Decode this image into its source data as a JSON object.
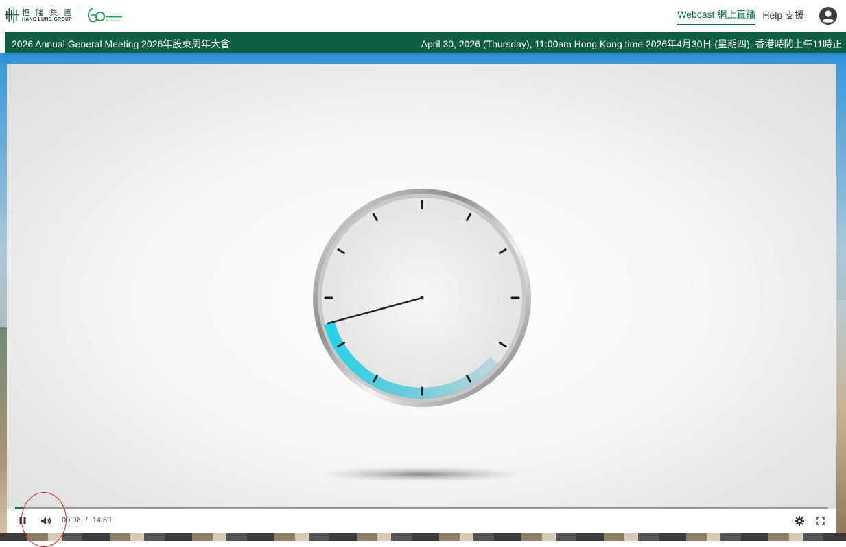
{
  "header": {
    "logo_cn": "恒 隆 集 團",
    "logo_en": "HANG LUNG GROUP",
    "anniversary_small": "and beyond",
    "nav": [
      {
        "label": "Webcast 網上直播",
        "active": true
      },
      {
        "label": "Help 支援",
        "active": false
      }
    ],
    "avatar_icon": "account-circle-icon"
  },
  "event": {
    "title": "2026 Annual General Meeting 2026年股東周年大會",
    "datetime": "April 30, 2026 (Thursday), 11:00am Hong Kong time 2026年4月30日 (星期四), 香港時間上午11時正"
  },
  "player": {
    "current_time": "00:08",
    "duration": "14:59",
    "time_separator": "/",
    "progress_fraction": 0.009,
    "state": "playing",
    "icons": {
      "play_pause": "pause-icon",
      "volume": "volume-icon",
      "settings": "gear-icon",
      "fullscreen": "fullscreen-icon"
    }
  },
  "colors": {
    "brand_green": "#0e5f43",
    "active_link": "#0c6b4b",
    "clock_accent": "#27c6de",
    "annotation": "#e5202a"
  }
}
